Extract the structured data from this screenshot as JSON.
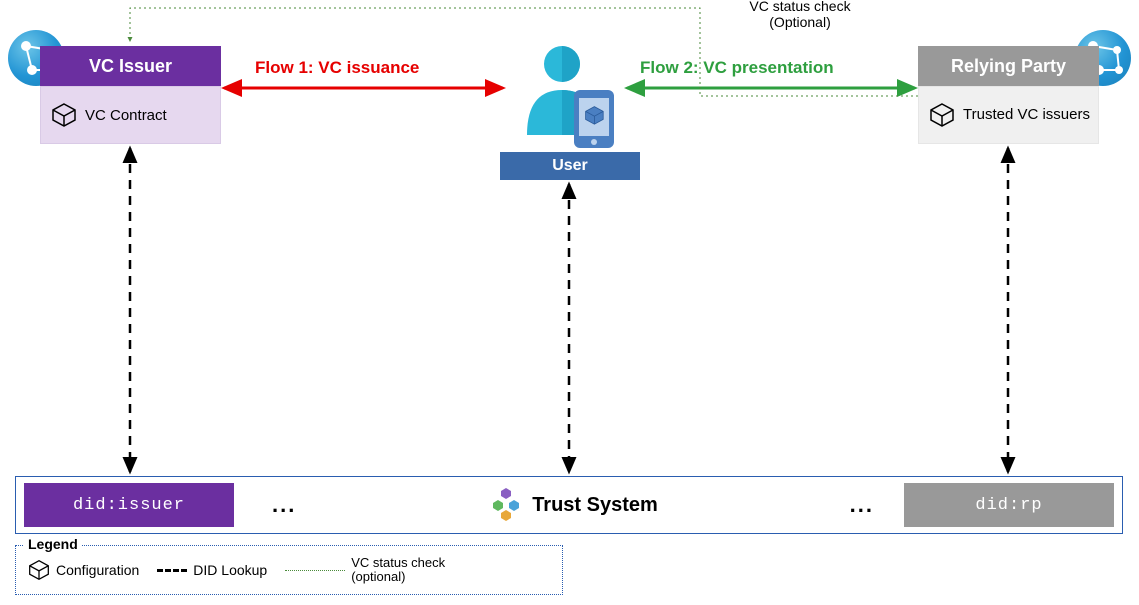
{
  "issuer": {
    "title": "VC Issuer",
    "config_label": "VC Contract",
    "did": "did:issuer"
  },
  "relying_party": {
    "title": "Relying Party",
    "config_label": "Trusted VC issuers",
    "did": "did:rp"
  },
  "user": {
    "label": "User"
  },
  "flows": {
    "flow1": "Flow 1: VC  issuance",
    "flow2": "Flow 2: VC presentation",
    "status_check_line1": "VC status check",
    "status_check_line2": "(Optional)"
  },
  "trust_system": {
    "label": "Trust System",
    "ellipsis": "..."
  },
  "legend": {
    "title": "Legend",
    "configuration": "Configuration",
    "did_lookup": "DID Lookup",
    "status_check_line1": "VC status check",
    "status_check_line2": "(optional)"
  },
  "colors": {
    "purple": "#6b2fa0",
    "grey": "#999999",
    "red": "#e60000",
    "green": "#2e9f3f",
    "blue_user": "#3a6aa9",
    "cyan_user": "#2bb8d9"
  }
}
